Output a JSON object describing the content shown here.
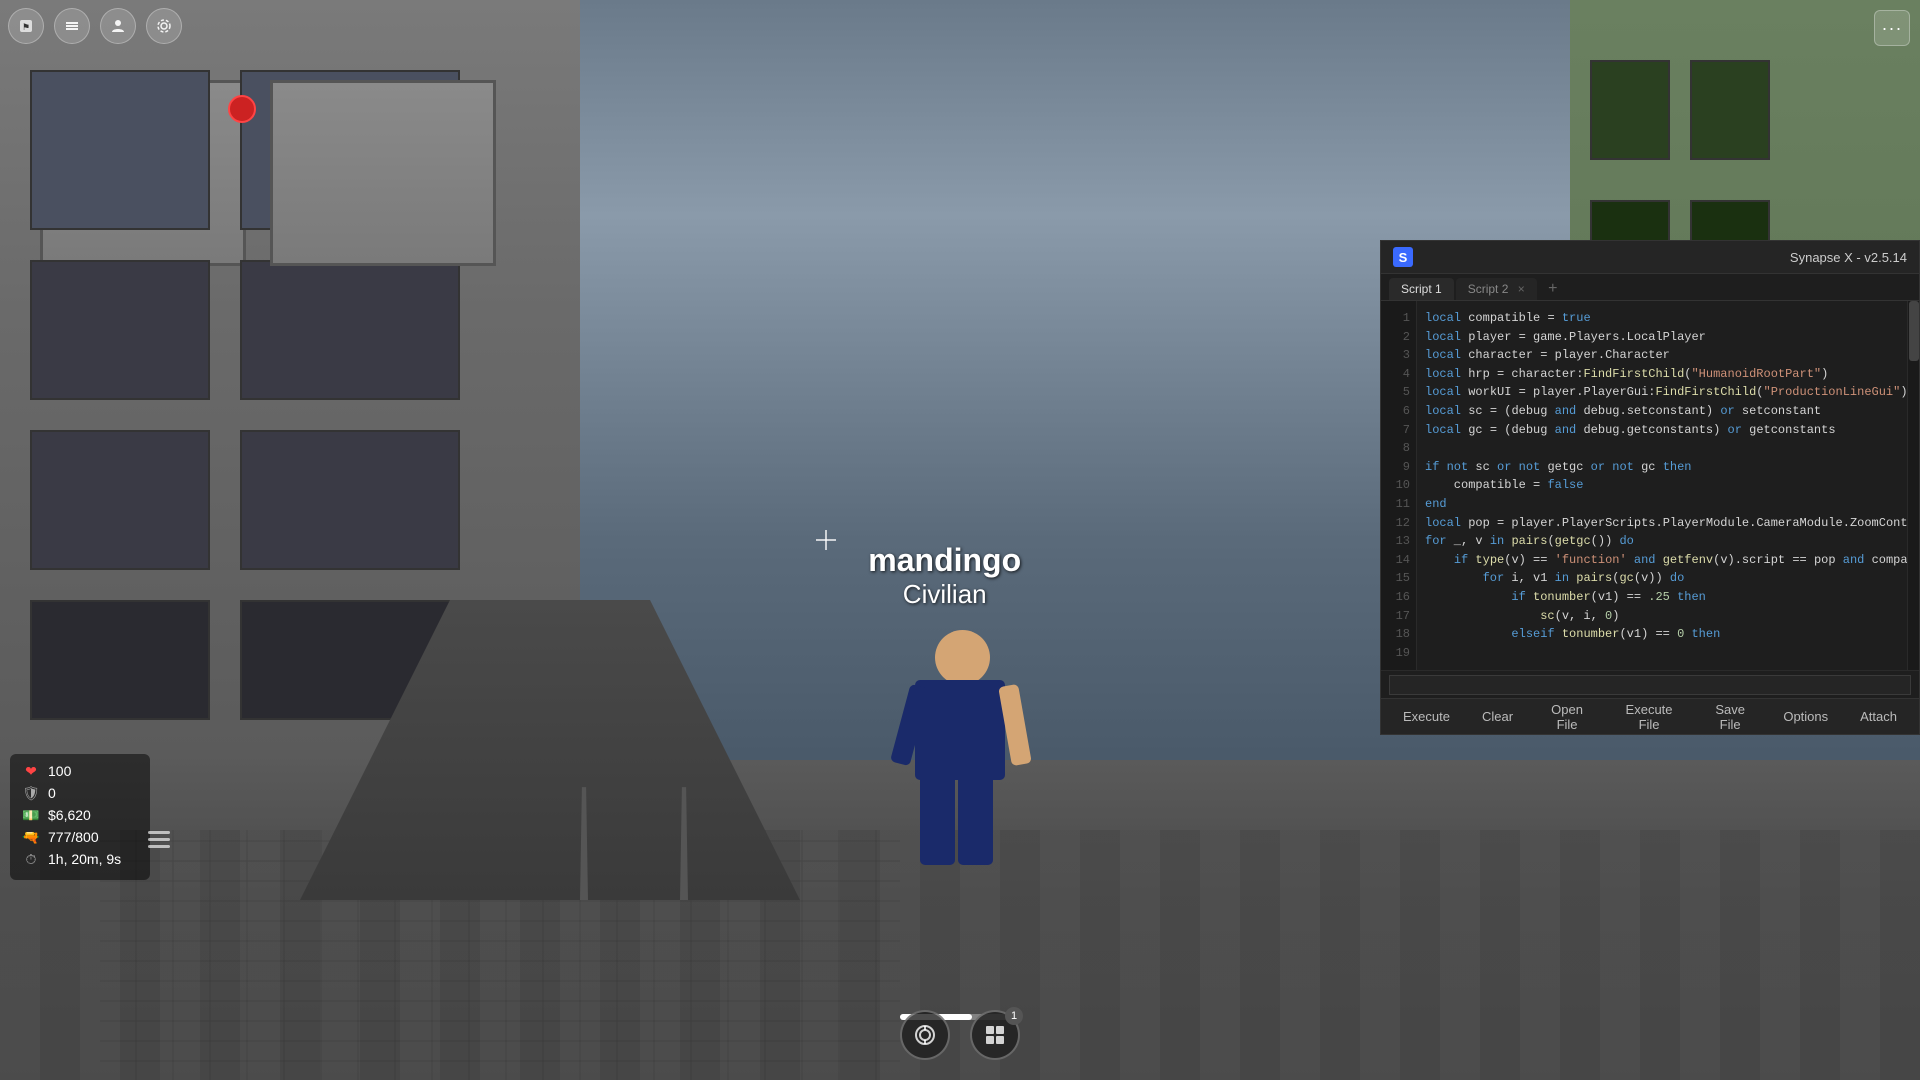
{
  "game": {
    "player_name": "mandingo",
    "player_role": "Civilian",
    "stats": {
      "health": "100",
      "health_label": "100",
      "shield": "0",
      "money": "$6,620",
      "ammo": "777/800",
      "time": "1h, 20m, 9s"
    },
    "bottom_badge": "1"
  },
  "synapse": {
    "title": "Synapse X - v2.5.14",
    "logo_letter": "S",
    "tabs": [
      {
        "label": "Script 1",
        "active": true,
        "closeable": false
      },
      {
        "label": "Script 2",
        "active": false,
        "closeable": true
      }
    ],
    "code_lines": [
      "local compatible = true",
      "local player = game.Players.LocalPlayer",
      "local character = player.Character",
      "local hrp = character:FindFirstChild(\"HumanoidRootPart\")",
      "local workUI = player.PlayerGui:FindFirstChild(\"ProductionLineGui\")",
      "local sc = (debug and debug.setconstant) or setconstant",
      "local gc = (debug and debug.getconstants) or getconstants",
      "",
      "if not sc or not getgc or not gc then",
      "    compatible = false",
      "end",
      "local pop = player.PlayerScripts.PlayerModule.CameraModule.ZoomController.Popper",
      "for _, v in pairs(getgc()) do",
      "    if type(v) == 'function' and getfenv(v).script == pop and compatible == true then",
      "        for i, v1 in pairs(gc(v)) do",
      "            if tonumber(v1) == .25 then",
      "                sc(v, i, 0)",
      "            elseif tonumber(v1) == 0 then"
    ],
    "toolbar": {
      "execute_label": "Execute",
      "clear_label": "Clear",
      "open_file_label": "Open File",
      "execute_file_label": "Execute File",
      "save_file_label": "Save File",
      "options_label": "Options",
      "attach_label": "Attach"
    }
  },
  "ui": {
    "top_icons": [
      "⚑",
      "☰",
      "✦",
      "⚙"
    ],
    "dots_btn": "···"
  }
}
